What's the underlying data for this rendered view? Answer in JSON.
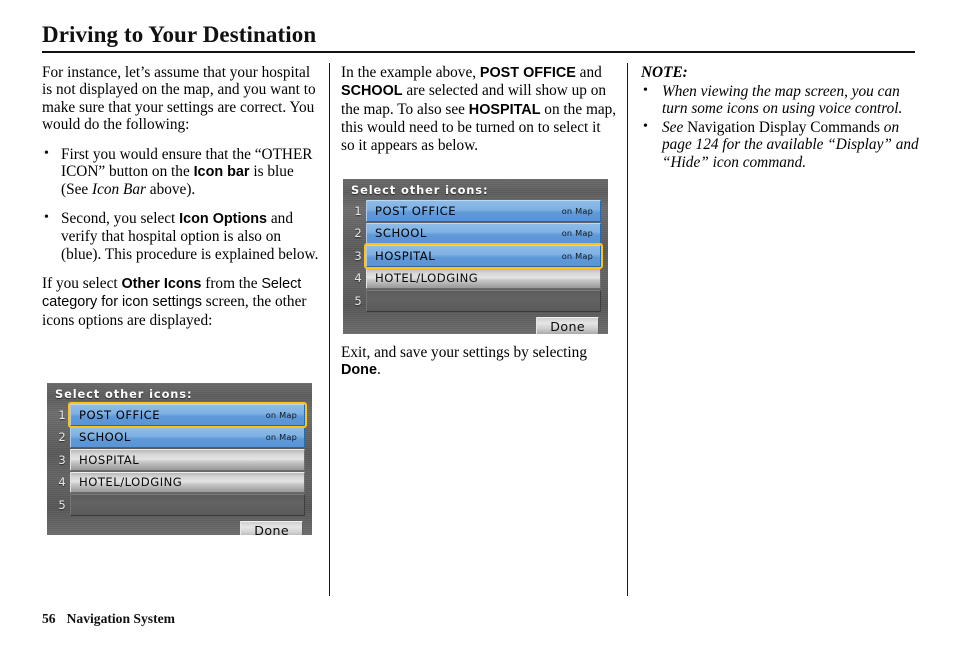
{
  "page": {
    "title": "Driving to Your Destination",
    "footer_page_number": "56",
    "footer_section": "Navigation System"
  },
  "col1": {
    "intro": "For instance, let’s assume that your hospital is not displayed on the map, and you want to make sure that your settings are correct. You would do the following:",
    "bullets": [
      {
        "part1": "First you would ensure that the “OTHER ICON” button on the ",
        "emph_sans": "Icon bar",
        "part2": " is blue (See ",
        "emph_italic": "Icon Bar",
        "part3": " above)."
      },
      {
        "part1": "Second, you select ",
        "emph_sans": "Icon Options",
        "part2": " and verify that hospital option is also on (blue). This procedure is explained below."
      }
    ],
    "paragraph2": {
      "part1": "If you select ",
      "emph_sans": "Other Icons",
      "part2": " from the ",
      "screen_name": "Select category for icon settings",
      "part3": " screen, the other icons options are displayed:"
    }
  },
  "col2": {
    "paragraph1": {
      "part1": "In the example above, ",
      "emph1": "POST OFFICE",
      "part2": " and ",
      "emph2": "SCHOOL",
      "part3": " are selected and will show up on the map. To also see ",
      "emph3": "HOSPITAL",
      "part4": " on the map, this would need to be turned on to select it so it appears as below."
    },
    "paragraph2": {
      "part1": "Exit, and save your settings by selecting ",
      "emph1": "Done",
      "part2": "."
    }
  },
  "col3": {
    "note_title": "NOTE:",
    "notes": [
      {
        "italic_all": "When viewing the map screen, you can turn some icons on using voice control."
      },
      {
        "part1": "See ",
        "roman": "Navigation Display Commands",
        "part2": " on page 124  for the available “Display” and “Hide” icon command."
      }
    ]
  },
  "nav_screen_1": {
    "header": "Select other icons:",
    "rows": [
      {
        "num": "1",
        "label": "POST OFFICE",
        "state": "on",
        "tag": "on Map",
        "focused": true
      },
      {
        "num": "2",
        "label": "SCHOOL",
        "state": "on",
        "tag": "on Map",
        "focused": false
      },
      {
        "num": "3",
        "label": "HOSPITAL",
        "state": "off",
        "tag": "",
        "focused": false
      },
      {
        "num": "4",
        "label": "HOTEL/LODGING",
        "state": "off",
        "tag": "",
        "focused": false
      },
      {
        "num": "5",
        "label": "",
        "state": "empty",
        "tag": "",
        "focused": false
      }
    ],
    "done_label": "Done"
  },
  "nav_screen_2": {
    "header": "Select other icons:",
    "rows": [
      {
        "num": "1",
        "label": "POST OFFICE",
        "state": "on",
        "tag": "on Map",
        "focused": false
      },
      {
        "num": "2",
        "label": "SCHOOL",
        "state": "on",
        "tag": "on Map",
        "focused": false
      },
      {
        "num": "3",
        "label": "HOSPITAL",
        "state": "on",
        "tag": "on Map",
        "focused": true
      },
      {
        "num": "4",
        "label": "HOTEL/LODGING",
        "state": "off",
        "tag": "",
        "focused": false
      },
      {
        "num": "5",
        "label": "",
        "state": "empty",
        "tag": "",
        "focused": false
      }
    ],
    "done_label": "Done"
  },
  "colors": {
    "selected_blue": "#7fb1e4",
    "focus_yellow": "#ffc21a",
    "screen_bg_grey": "#626262",
    "inactive_silver": "#d7d7d7"
  }
}
